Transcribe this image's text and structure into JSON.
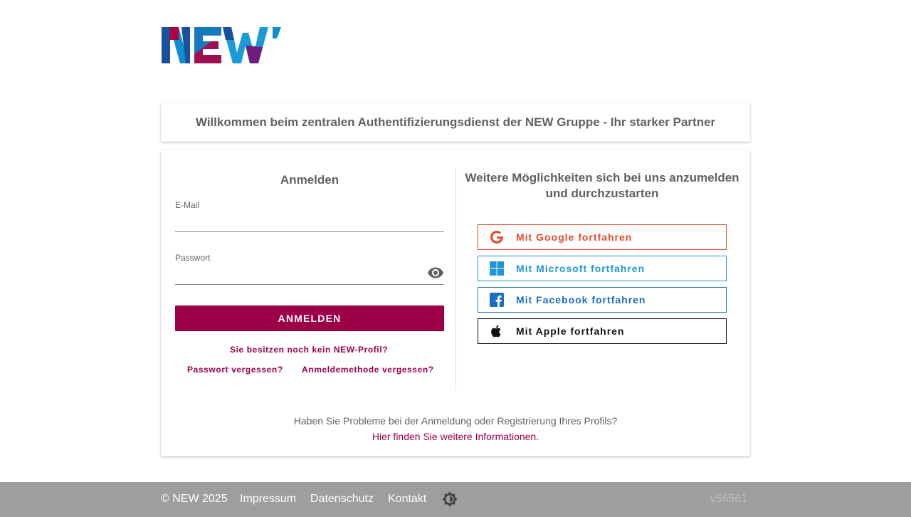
{
  "brand": {
    "logo_text": "NEW’"
  },
  "welcome": {
    "text": "Willkommen beim zentralen Authentifizierungsdienst der NEW Gruppe - Ihr starker Partner"
  },
  "login": {
    "title": "Anmelden",
    "email_label": "E-Mail",
    "email_value": "",
    "password_label": "Passwort",
    "password_value": "",
    "submit_label": "ANMELDEN",
    "no_profile_link": "Sie besitzen noch kein NEW-Profil?",
    "forgot_password_link": "Passwort vergessen?",
    "forgot_method_link": "Anmeldemethode vergessen?"
  },
  "social": {
    "title": "Weitere Möglichkeiten sich bei uns anzumelden und durchzustarten",
    "buttons": [
      {
        "label": "Mit Google fortfahren",
        "icon": "google-icon",
        "color": "#e4492d"
      },
      {
        "label": "Mit Microsoft fortfahren",
        "icon": "microsoft-icon",
        "color": "#1e97d4"
      },
      {
        "label": "Mit Facebook fortfahren",
        "icon": "facebook-icon",
        "color": "#1b6ec2"
      },
      {
        "label": "Mit Apple fortfahren",
        "icon": "apple-icon",
        "color": "#111111"
      }
    ]
  },
  "help": {
    "text": "Haben Sie Probleme bei der Anmeldung oder Registrierung Ihres Profils?",
    "link": "Hier finden Sie weitere Informationen."
  },
  "footer": {
    "copyright": "© NEW 2025",
    "impressum": "Impressum",
    "datenschutz": "Datenschutz",
    "kontakt": "Kontakt",
    "theme_icon": "brightness-icon",
    "version": "v56561"
  },
  "colors": {
    "accent": "#9b0046",
    "footer_bg": "#9e9e9e"
  }
}
